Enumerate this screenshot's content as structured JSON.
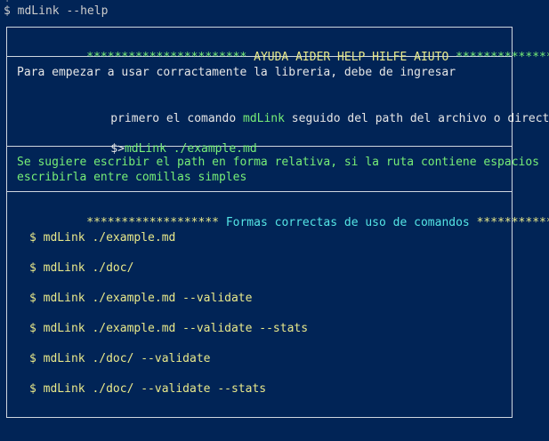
{
  "terminal": {
    "top_fragment": "$ ...",
    "command_prompt": "$ mdLink --help"
  },
  "help": {
    "banner": {
      "stars_left": "***********************",
      "title": " AYUDA AIDER HELP HILFE AIUTO ",
      "stars_right": "************************"
    },
    "intro": {
      "line1": "Para empezar a usar corractamente la libreria, debe de ingresar",
      "line2_prefix": "primero el comando ",
      "line2_command": "mdLink",
      "line2_suffix": " seguido del path del archivo o directorio:",
      "example_prompt": "$>",
      "example_command": "mdLink ./example.md"
    },
    "suggestion": {
      "line1": "Se sugiere escribir el path en forma relativa, si la ruta contiene espacios",
      "line2": "escribirla entre comillas simples"
    },
    "usage": {
      "stars_left": "*******************",
      "title": " Formas correctas de uso de comandos ",
      "stars_right": "*******************",
      "commands": [
        "$ mdLink ./example.md",
        "$ mdLink ./doc/",
        "$ mdLink ./example.md --validate",
        "$ mdLink ./example.md --validate --stats",
        "$ mdLink ./doc/ --validate",
        "$ mdLink ./doc/ --validate --stats"
      ]
    }
  }
}
